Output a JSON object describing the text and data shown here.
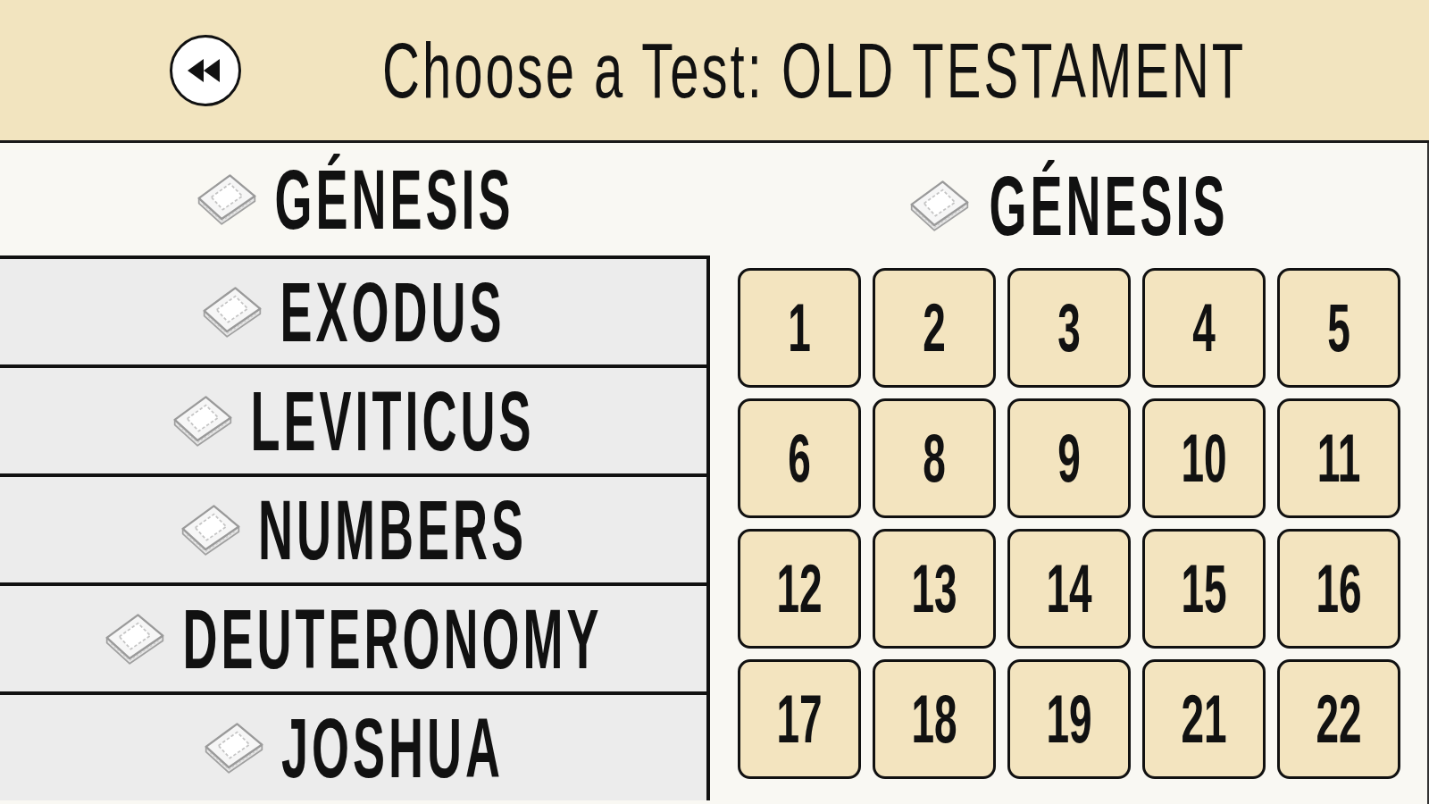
{
  "header": {
    "title": "Choose a Test: OLD TESTAMENT"
  },
  "books": [
    {
      "name": "GÉNESIS",
      "selected": true
    },
    {
      "name": "EXODUS",
      "selected": false
    },
    {
      "name": "LEVITICUS",
      "selected": false
    },
    {
      "name": "NUMBERS",
      "selected": false
    },
    {
      "name": "DEUTERONOMY",
      "selected": false
    },
    {
      "name": "JOSHUA",
      "selected": false
    }
  ],
  "chapters_panel": {
    "title": "GÉNESIS",
    "chapters": [
      "1",
      "2",
      "3",
      "4",
      "5",
      "6",
      "8",
      "9",
      "10",
      "11",
      "12",
      "13",
      "14",
      "15",
      "16",
      "17",
      "18",
      "19",
      "21",
      "22"
    ]
  }
}
